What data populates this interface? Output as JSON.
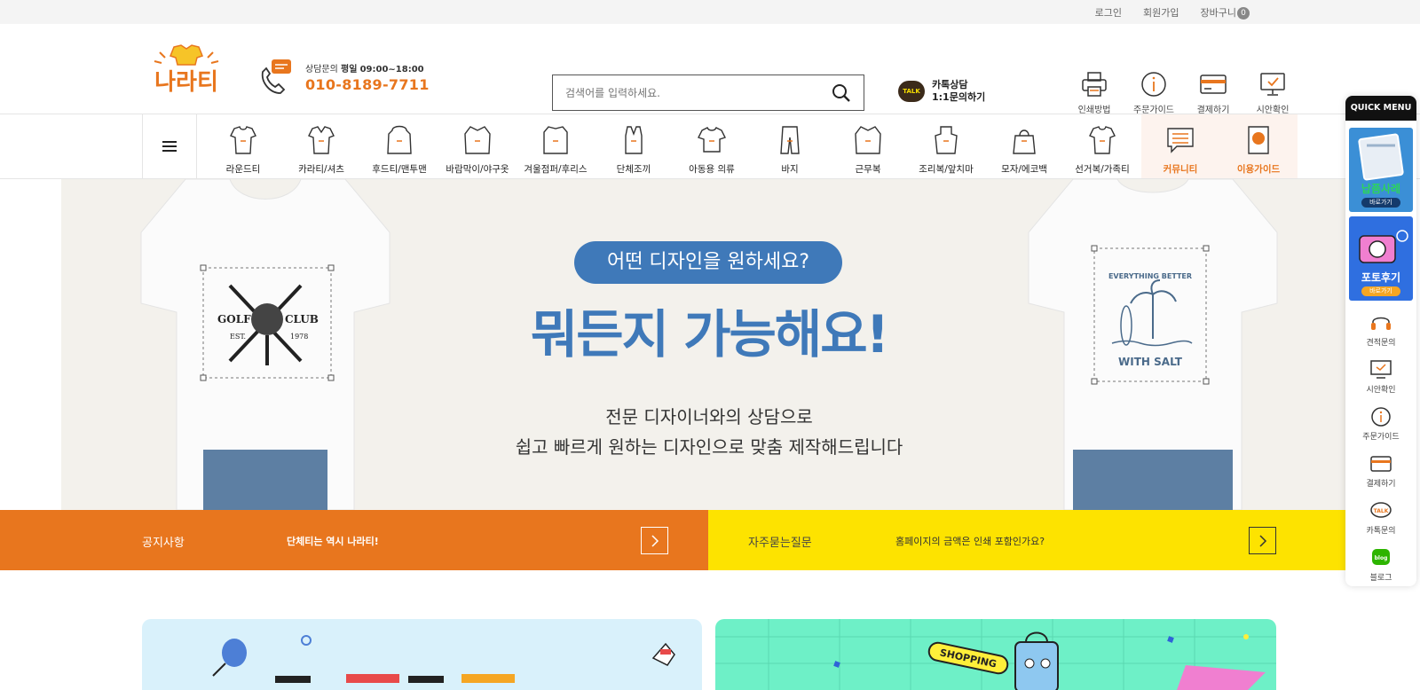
{
  "topbar": {
    "login": "로그인",
    "signup": "회원가입",
    "cart": "장바구니",
    "cart_count": "0"
  },
  "header": {
    "logo_text": "나라티",
    "phone_label": "상담문의",
    "phone_hours_label": "평일",
    "phone_hours": "09:00~18:00",
    "phone_number": "010-8189-7711",
    "search_placeholder": "검색어를 입력하세요.",
    "talk_line1": "카톡상담",
    "talk_line2": "1:1문의하기",
    "talk_badge": "TALK",
    "quick": [
      "인쇄방법",
      "주문가이드",
      "결제하기",
      "시안확인"
    ]
  },
  "nav": {
    "categories": [
      "라운드티",
      "카라티/셔츠",
      "후드티/맨투맨",
      "바람막이/야구옷",
      "겨울점퍼/후리스",
      "단체조끼",
      "아동용 의류",
      "바지",
      "근무복",
      "조리복/앞치마",
      "모자/에코백",
      "선거복/가족티",
      "커뮤니티",
      "이용가이드"
    ]
  },
  "hero": {
    "pill": "어떤 디자인을 원하세요?",
    "headline": "뭐든지 가능해요!",
    "sub1": "전문 디자이너와의 상담으로",
    "sub2": "쉽고 빠르게 원하는 디자인으로 맞춤 제작해드립니다",
    "shirt_left": {
      "word1": "GOLF",
      "word2": "CLUB",
      "est": "EST.",
      "year": "1978"
    },
    "shirt_right": {
      "top": "EVERYTHING BETTER",
      "bottom": "WITH SALT"
    }
  },
  "notice": {
    "title": "공지사항",
    "text": "단체티는 역시 나라티!"
  },
  "faq": {
    "title": "자주묻는질문",
    "text": "홈페이지의 금액은 인쇄 포함인가요?"
  },
  "quickmenu": {
    "title": "QUICK MENU",
    "banner1": "납품사례",
    "banner2": "포토후기",
    "go": "바로가기",
    "items": [
      "견적문의",
      "시안확인",
      "주문가이드",
      "결제하기",
      "카톡문의",
      "블로그"
    ],
    "talk_badge": "TALK",
    "blog_badge": "blog"
  },
  "card2_sticker": "SHOPPING",
  "colors": {
    "orange": "#e8761e",
    "blue": "#3f79b9",
    "yellow": "#fde300"
  }
}
